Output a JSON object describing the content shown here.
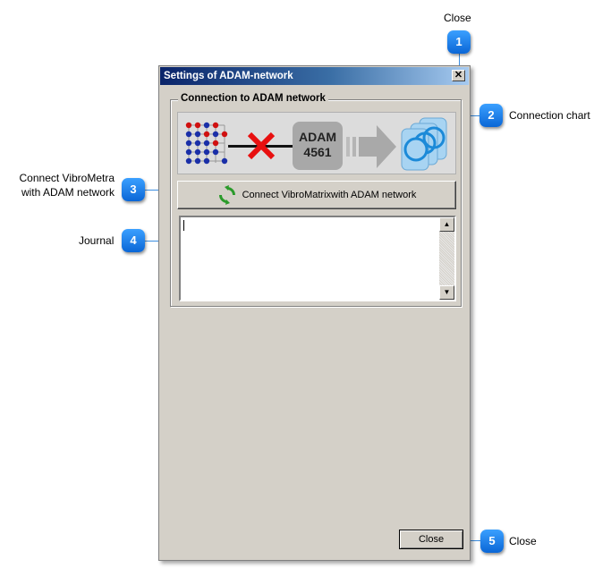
{
  "window": {
    "title": "Settings of ADAM-network",
    "close_glyph": "✕"
  },
  "group": {
    "title": "Connection to ADAM network"
  },
  "chart": {
    "device_line1": "ADAM",
    "device_line2": "4561",
    "status_icon": "red-x-icon"
  },
  "connect_button": {
    "label": "Connect VibroMatrixwith ADAM network",
    "icon": "refresh-icon"
  },
  "journal": {
    "value": ""
  },
  "close_button": {
    "label": "Close"
  },
  "callouts": [
    {
      "number": "1",
      "label": "Close"
    },
    {
      "number": "2",
      "label": "Connection chart"
    },
    {
      "number": "3",
      "label_line1": "Connect VibroMetra",
      "label_line2": "with ADAM network"
    },
    {
      "number": "4",
      "label": "Journal"
    },
    {
      "number": "5",
      "label": "Close"
    }
  ],
  "colors": {
    "accent": "#1a7ae8",
    "window_bg": "#d4d0c8",
    "title_start": "#0a246a",
    "title_end": "#a6caf0"
  }
}
